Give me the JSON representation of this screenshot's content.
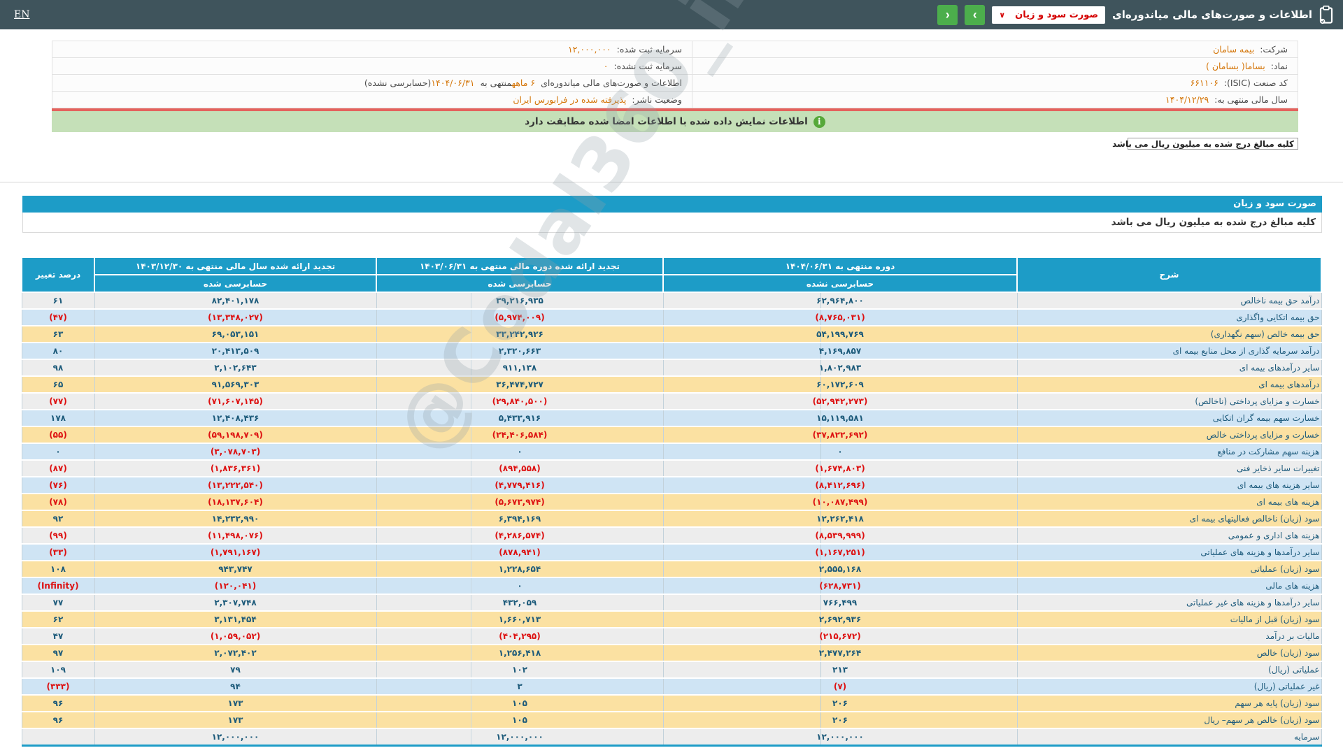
{
  "topbar": {
    "en_label": "EN",
    "title": "اطلاعات و صورت‌های مالی میاندوره‌ای",
    "statement_select": {
      "value": "صورت سود و زیان",
      "chevron_glyph": "∨"
    },
    "nav": {
      "forward_glyph": "›",
      "back_glyph": "‹"
    }
  },
  "company_info": {
    "rows": [
      {
        "right": [
          {
            "text": "شرکت:  ",
            "kind": "label"
          },
          {
            "text": "بیمه سامان",
            "kind": "value"
          }
        ],
        "left": [
          {
            "text": "سرمایه ثبت شده:  ",
            "kind": "label"
          },
          {
            "text": "۱۲,۰۰۰,۰۰۰",
            "kind": "value"
          }
        ]
      },
      {
        "right": [
          {
            "text": "نماد:  ",
            "kind": "label"
          },
          {
            "text": "بساما( بسامان )",
            "kind": "value"
          }
        ],
        "left": [
          {
            "text": "سرمایه ثبت نشده:  ",
            "kind": "label"
          },
          {
            "text": "۰",
            "kind": "value"
          }
        ]
      },
      {
        "right": [
          {
            "text": "کد صنعت (ISIC):  ",
            "kind": "label"
          },
          {
            "text": "۶۶۱۱۰۶",
            "kind": "value"
          }
        ],
        "left": [
          {
            "text": "اطلاعات و صورت‌های مالی میاندوره‌ای ",
            "kind": "label"
          },
          {
            "text": "۶ ماهه",
            "kind": "value"
          },
          {
            "text": "منتهی به ",
            "kind": "label"
          },
          {
            "text": "۱۴۰۴/۰۶/۳۱",
            "kind": "value"
          },
          {
            "text": "(حسابرسی نشده)",
            "kind": "label"
          }
        ]
      },
      {
        "right": [
          {
            "text": "سال مالی منتهی به:  ",
            "kind": "label"
          },
          {
            "text": "۱۴۰۴/۱۲/۲۹",
            "kind": "value"
          }
        ],
        "left": [
          {
            "text": "وضعیت ناشر:  ",
            "kind": "label"
          },
          {
            "text": "پذیرفته شده در فرابورس ایران",
            "kind": "value"
          }
        ]
      }
    ]
  },
  "banner": {
    "text": "اطلاعات نمایش داده شده با اطلاعات امضا شده مطابقت دارد",
    "icon_glyph": "i"
  },
  "units_note": "کلیه مبالغ درج شده به میلیون ریال می باشد",
  "section": {
    "title": "صورت سود و زیان",
    "units_note": "کلیه مبالغ درج شده به میلیون ریال می باشد"
  },
  "watermark": "@Codal360_ir",
  "statement": {
    "columns": {
      "desc": "شرح",
      "p1_title": "دوره منتهی به ۱۴۰۴/۰۶/۳۱",
      "p1_sub": "حسابرسی نشده",
      "p2_title": "تجدید ارائه شده دوره مالی منتهی به ۱۴۰۳/۰۶/۳۱",
      "p2_sub": "حسابرسی شده",
      "p3_title": "تجدید ارائه شده سال مالی منتهی به ۱۴۰۳/۱۲/۳۰",
      "p3_sub": "حسابرسی شده",
      "pct": "درصد تغییر"
    },
    "rows": [
      {
        "label": "درآمد حق بیمه ناخالص",
        "p1": "۶۲,۹۶۴,۸۰۰",
        "p2": "۳۹,۲۱۶,۹۳۵",
        "p3": "۸۲,۴۰۱,۱۷۸",
        "pct": "۶۱",
        "type": "gray"
      },
      {
        "label": "حق بیمه اتکایی واگذاری",
        "p1": "(۸,۷۶۵,۰۳۱)",
        "p2": "(۵,۹۷۴,۰۰۹)",
        "p3": "(۱۳,۳۴۸,۰۲۷)",
        "pct": "(۴۷)",
        "type": "blue"
      },
      {
        "label": "حق بیمه خالص (سهم نگهداری)",
        "p1": "۵۴,۱۹۹,۷۶۹",
        "p2": "۳۳,۲۴۲,۹۲۶",
        "p3": "۶۹,۰۵۳,۱۵۱",
        "pct": "۶۳",
        "type": "yellow"
      },
      {
        "label": "درآمد سرمایه گذاری از محل منابع بیمه ای",
        "p1": "۴,۱۶۹,۸۵۷",
        "p2": "۲,۳۲۰,۶۶۳",
        "p3": "۲۰,۴۱۳,۵۰۹",
        "pct": "۸۰",
        "type": "blue"
      },
      {
        "label": "سایر درآمدهای بیمه ای",
        "p1": "۱,۸۰۲,۹۸۳",
        "p2": "۹۱۱,۱۳۸",
        "p3": "۲,۱۰۲,۶۴۳",
        "pct": "۹۸",
        "type": "gray"
      },
      {
        "label": "درآمدهای بیمه ای",
        "p1": "۶۰,۱۷۲,۶۰۹",
        "p2": "۳۶,۴۷۴,۷۲۷",
        "p3": "۹۱,۵۶۹,۳۰۳",
        "pct": "۶۵",
        "type": "yellow"
      },
      {
        "label": "خسارت و مزایای پرداختی (ناخالص)",
        "p1": "(۵۲,۹۴۲,۲۷۳)",
        "p2": "(۲۹,۸۴۰,۵۰۰)",
        "p3": "(۷۱,۶۰۷,۱۴۵)",
        "pct": "(۷۷)",
        "type": "gray"
      },
      {
        "label": "خسارت سهم بیمه گران اتکایی",
        "p1": "۱۵,۱۱۹,۵۸۱",
        "p2": "۵,۴۳۳,۹۱۶",
        "p3": "۱۲,۴۰۸,۴۳۶",
        "pct": "۱۷۸",
        "type": "blue"
      },
      {
        "label": "خسارت و مزایای پرداختی خالص",
        "p1": "(۳۷,۸۲۲,۶۹۲)",
        "p2": "(۲۴,۴۰۶,۵۸۴)",
        "p3": "(۵۹,۱۹۸,۷۰۹)",
        "pct": "(۵۵)",
        "type": "yellow"
      },
      {
        "label": "هزینه سهم مشارکت در منافع",
        "p1": "۰",
        "p2": "۰",
        "p3": "(۳,۰۷۸,۷۰۳)",
        "pct": "۰",
        "type": "blue"
      },
      {
        "label": "تغییرات سایر ذخایر فنی",
        "p1": "(۱,۶۷۴,۸۰۳)",
        "p2": "(۸۹۴,۵۵۸)",
        "p3": "(۱,۸۳۶,۳۶۱)",
        "pct": "(۸۷)",
        "type": "gray"
      },
      {
        "label": "سایر هزینه های بیمه ای",
        "p1": "(۸,۴۱۲,۶۹۶)",
        "p2": "(۴,۷۷۹,۴۱۶)",
        "p3": "(۱۳,۲۲۲,۵۴۰)",
        "pct": "(۷۶)",
        "type": "blue"
      },
      {
        "label": "هزینه های بیمه ای",
        "p1": "(۱۰,۰۸۷,۴۹۹)",
        "p2": "(۵,۶۷۳,۹۷۴)",
        "p3": "(۱۸,۱۳۷,۶۰۴)",
        "pct": "(۷۸)",
        "type": "yellow"
      },
      {
        "label": "سود (زیان) ناخالص فعالیتهای بیمه ای",
        "p1": "۱۲,۲۶۲,۴۱۸",
        "p2": "۶,۳۹۴,۱۶۹",
        "p3": "۱۴,۲۳۲,۹۹۰",
        "pct": "۹۲",
        "type": "yellow"
      },
      {
        "label": "هزینه های اداری و عمومی",
        "p1": "(۸,۵۳۹,۹۹۹)",
        "p2": "(۴,۲۸۶,۵۷۴)",
        "p3": "(۱۱,۴۹۸,۰۷۶)",
        "pct": "(۹۹)",
        "type": "gray"
      },
      {
        "label": "سایر درآمدها و هزینه های عملیاتی",
        "p1": "(۱,۱۶۷,۲۵۱)",
        "p2": "(۸۷۸,۹۴۱)",
        "p3": "(۱,۷۹۱,۱۶۷)",
        "pct": "(۳۳)",
        "type": "blue"
      },
      {
        "label": "سود (زیان) عملیاتی",
        "p1": "۲,۵۵۵,۱۶۸",
        "p2": "۱,۲۲۸,۶۵۴",
        "p3": "۹۴۳,۷۴۷",
        "pct": "۱۰۸",
        "type": "yellow"
      },
      {
        "label": "هزینه های مالی",
        "p1": "(۶۲۸,۷۳۱)",
        "p2": "۰",
        "p3": "(۱۲۰,۰۴۱)",
        "pct": "(Infinity)",
        "type": "blue"
      },
      {
        "label": "سایر درآمدها و هزینه های غیر عملیاتی",
        "p1": "۷۶۶,۴۹۹",
        "p2": "۴۳۲,۰۵۹",
        "p3": "۲,۳۰۷,۷۴۸",
        "pct": "۷۷",
        "type": "gray"
      },
      {
        "label": "سود (زیان) قبل از مالیات",
        "p1": "۲,۶۹۲,۹۳۶",
        "p2": "۱,۶۶۰,۷۱۳",
        "p3": "۳,۱۳۱,۴۵۴",
        "pct": "۶۲",
        "type": "yellow"
      },
      {
        "label": "مالیات بر درآمد",
        "p1": "(۲۱۵,۶۷۲)",
        "p2": "(۴۰۴,۲۹۵)",
        "p3": "(۱,۰۵۹,۰۵۲)",
        "pct": "۴۷",
        "type": "gray"
      },
      {
        "label": "سود (زیان) خالص",
        "p1": "۲,۴۷۷,۲۶۴",
        "p2": "۱,۲۵۶,۴۱۸",
        "p3": "۲,۰۷۲,۴۰۲",
        "pct": "۹۷",
        "type": "yellow"
      },
      {
        "label": "عملیاتی (ریال)",
        "p1": "۲۱۳",
        "p2": "۱۰۲",
        "p3": "۷۹",
        "pct": "۱۰۹",
        "type": "gray"
      },
      {
        "label": "غیر عملیاتی (ریال)",
        "p1": "(۷)",
        "p2": "۳",
        "p3": "۹۴",
        "pct": "(۳۳۳)",
        "type": "blue"
      },
      {
        "label": "سود (زیان) پایه هر سهم",
        "p1": "۲۰۶",
        "p2": "۱۰۵",
        "p3": "۱۷۳",
        "pct": "۹۶",
        "type": "yellow"
      },
      {
        "label": "سود (زیان) خالص هر سهم– ریال",
        "p1": "۲۰۶",
        "p2": "۱۰۵",
        "p3": "۱۷۳",
        "pct": "۹۶",
        "type": "yellow"
      },
      {
        "label": "سرمایه",
        "p1": "۱۲,۰۰۰,۰۰۰",
        "p2": "۱۲,۰۰۰,۰۰۰",
        "p3": "۱۲,۰۰۰,۰۰۰",
        "pct": "",
        "type": "gray"
      }
    ]
  },
  "colors": {
    "topbar_dark": "#3f545c",
    "header_blue": "#1d9cc7",
    "button_green": "#4cae4c",
    "banner_green": "#c5e0b8",
    "line_red": "#e4625c",
    "value_orange": "#d4760a",
    "row_yellow": "#fbe1a2",
    "row_blue": "#cfe4f4",
    "row_gray": "#ededed",
    "negative_red": "#dd1111",
    "number_blue": "#1c5a7a"
  }
}
